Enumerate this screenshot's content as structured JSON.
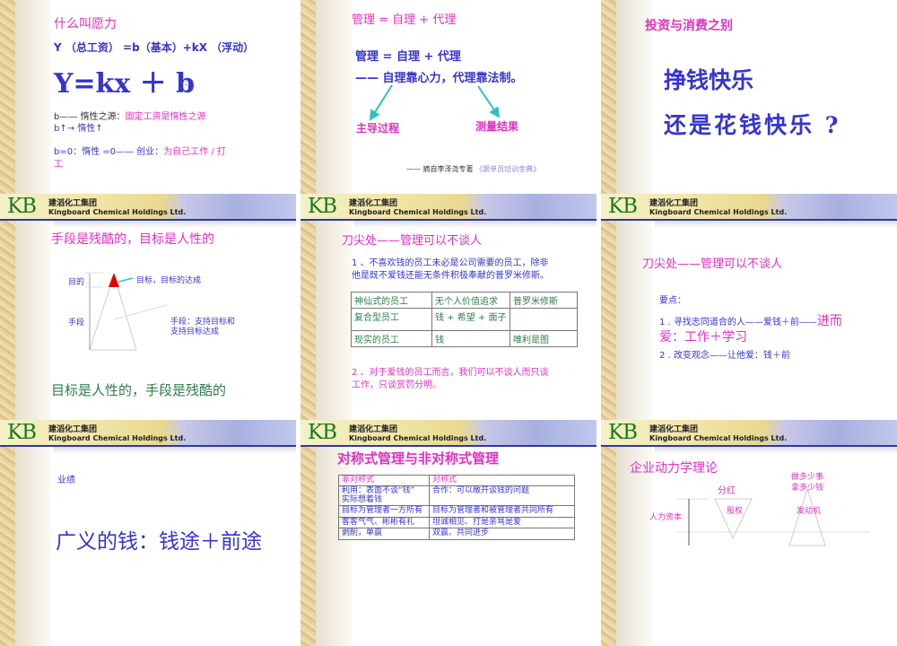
{
  "header": {
    "logo": "KB",
    "company_cn": "建滔化工集团",
    "company_en": "Kingboard Chemical Holdings Ltd."
  },
  "slides": {
    "s1": {
      "title": "什么叫愿力",
      "formula_desc": "Y （总工资） =b（基本）+kX （浮动）",
      "formula": "Y=kx ＋ b",
      "colon": ":",
      "l1a": "b—— 惰性之源：",
      "l1b": "固定工资是惰性之源",
      "l2": "b↑→ 惰性↑",
      "l3a": "b=0：惰性 =0—— 创业：",
      "l3b": "为自己工作 / 打",
      "l3c": "工"
    },
    "s2": {
      "title": "管理 = 自理 + 代理",
      "line1": "管理 = 自理 + 代理",
      "line2": "—— 自理靠心力，代理靠法制。",
      "left": "主导过程",
      "right": "测量结果",
      "source": "—— 摘自李泽尧专著",
      "book": "《跟单员培训金典》"
    },
    "s3": {
      "title": "投资与消费之别",
      "line1": "挣钱快乐",
      "line2": "还是花钱快乐 ?"
    },
    "s4": {
      "title": "手段是残酷的，目标是人性的",
      "label_goal": "目的",
      "label_means": "手段",
      "note_goal": "目标，目标的达成",
      "note_means1": "手段：支持目标和",
      "note_means2": "支持目标达成",
      "bottom": "目标是人性的，手段是残酷的"
    },
    "s5": {
      "title": "刀尖处——管理可以不谈人",
      "p1a": "1 、不喜欢钱的员工未必是公司需要的员工，除非",
      "p1b": "他是既不爱钱还能无条件积极奉献的普罗米修斯。",
      "table": [
        [
          "神仙式的员工",
          "无个人价值追求",
          "普罗米修斯"
        ],
        [
          "复合型员工",
          "钱 + 希望 + 面子",
          ""
        ],
        [
          "现实的员工",
          "钱",
          "唯利是图"
        ]
      ],
      "p2a": "2 、对于爱钱的员工而言，我们可以不谈人而只谈",
      "p2b": "工作，只谈赏罚分明。"
    },
    "s6": {
      "title": "刀尖处——管理可以不谈人",
      "key": "要点：",
      "i1a": "1 . 寻找志同道合的人——爱钱＋前——",
      "i1b": "进而",
      "i1c": "爱：工作＋学习",
      "i2": "2 . 改变观念——让他爱：钱＋前"
    },
    "s7": {
      "label": "业绩",
      "big": "广义的钱：钱途＋前途"
    },
    "s8": {
      "title": "对称式管理与非对称式管理",
      "table": [
        [
          "非对称式",
          "对称式"
        ],
        [
          "利用：表面不谈“钱”\n实际想着钱",
          "合作：可以敞开谈钱的问题"
        ],
        [
          "目标为管理者一方所有",
          "目标为管理者和被管理者共同所有"
        ],
        [
          "客客气气、彬彬有礼",
          "坦诚相见、打是亲骂是爱"
        ],
        [
          "剥削，单赢",
          "双赢、共同进步"
        ]
      ]
    },
    "s9": {
      "title": "企业动力学理论",
      "top_right1": "做多少事",
      "top_right2": "拿多少钱",
      "dividend": "分红",
      "capital": "人力资本",
      "equity": "股权",
      "engine": "发动机"
    }
  }
}
